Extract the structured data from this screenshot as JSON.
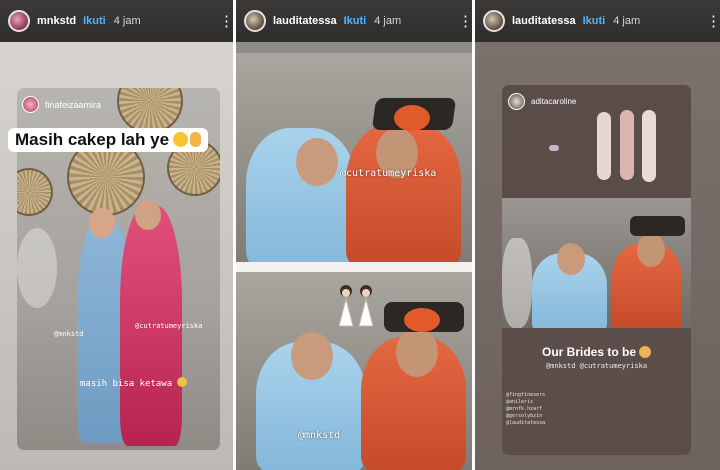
{
  "stories": [
    {
      "username": "mnkstd",
      "follow_label": "Ikuti",
      "time": "4 jam",
      "reposted_from": "finafeizaamira",
      "caption": "Masih cakep lah ye",
      "mention": "@mnkstd",
      "mention2": "@cutratumeyriska",
      "footer_text": "masih bisa ketawa"
    },
    {
      "username": "lauditatessa",
      "follow_label": "Ikuti",
      "time": "4 jam",
      "mention_top": "@cutratumeyriska",
      "mention_bottom": "@mnkstd"
    },
    {
      "username": "lauditatessa",
      "follow_label": "Ikuti",
      "time": "4 jam",
      "reposted_from": "aditacaroline",
      "caption": "Our Brides to be",
      "tags_line": "@mnkstd @cutratumeyriska",
      "hashtags": [
        "@fingfinesers",
        "@anilerix",
        "@mrnfk.hzarf",
        "@gersolybzin",
        "@lauditatessa"
      ]
    }
  ]
}
